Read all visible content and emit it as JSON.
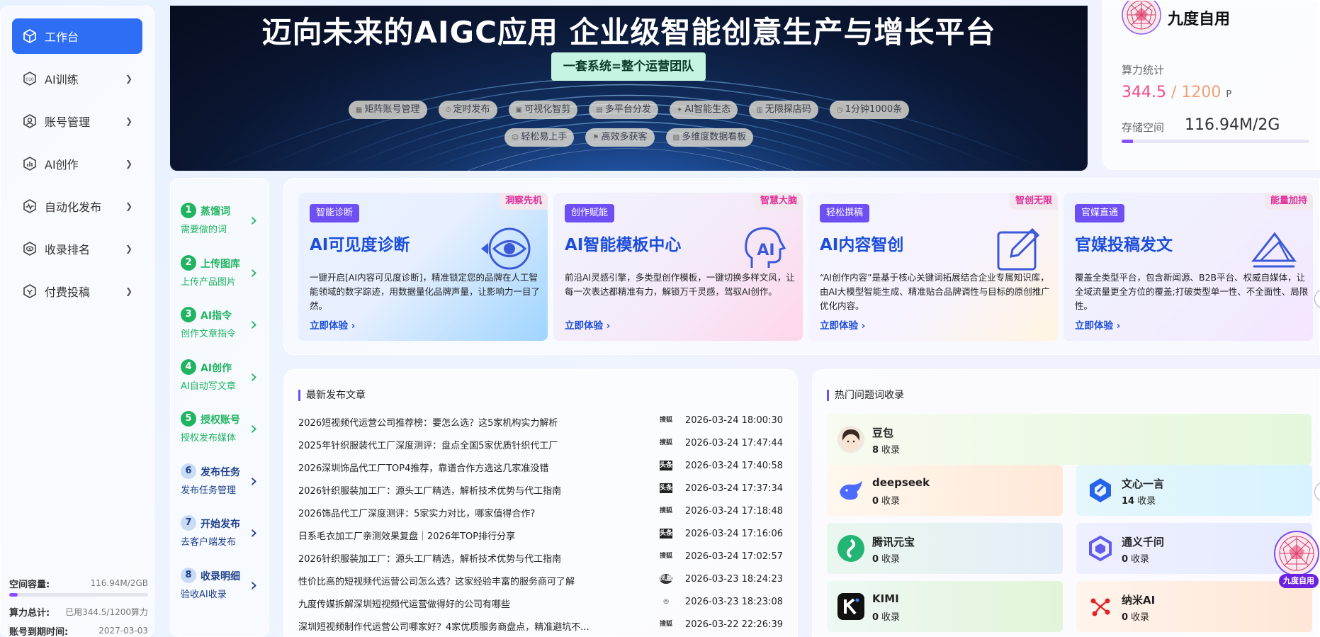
{
  "sidebar": {
    "items": [
      {
        "label": "工作台",
        "icon": "cube-icon",
        "active": true
      },
      {
        "label": "AI训练",
        "icon": "ai-train-icon"
      },
      {
        "label": "账号管理",
        "icon": "account-icon"
      },
      {
        "label": "AI创作",
        "icon": "chart-icon"
      },
      {
        "label": "自动化发布",
        "icon": "pulse-icon"
      },
      {
        "label": "收录排名",
        "icon": "eye-icon"
      },
      {
        "label": "付费投稿",
        "icon": "check-icon"
      }
    ],
    "stats": {
      "space_label": "空间容量:",
      "space_value": "116.94M/2GB",
      "space_fraction": 0.06,
      "compute_label": "算力总计:",
      "compute_value": "已用344.5/1200算力",
      "expire_label": "账号到期时间:",
      "expire_value": "2027-03-03"
    }
  },
  "banner": {
    "title": "迈向未来的AIGC应用  企业级智能创意生产与增长平台",
    "pill": "一套系统=整个运营团队",
    "tags_row1": [
      "矩阵账号管理",
      "定时发布",
      "可视化智剪",
      "多平台分发",
      "AI智能生态",
      "无限探店码",
      "1分钟1000条"
    ],
    "tags_row2": [
      "轻松易上手",
      "高效多获客",
      "多维度数据看板"
    ]
  },
  "profile": {
    "name": "九度自用",
    "compute_label": "算力统计",
    "compute_used": "344.5",
    "compute_sep": " / ",
    "compute_total": "1200",
    "compute_unit": "P",
    "storage_label": "存储空间",
    "storage_value": "116.94M/2G",
    "storage_fraction": 0.06
  },
  "steps": [
    {
      "num": "1",
      "title": "蒸馏词",
      "sub": "需要做的词",
      "style": "g"
    },
    {
      "num": "2",
      "title": "上传图库",
      "sub": "上传产品图片",
      "style": "g"
    },
    {
      "num": "3",
      "title": "AI指令",
      "sub": "创作文章指令",
      "style": "g"
    },
    {
      "num": "4",
      "title": "AI创作",
      "sub": "AI自动写文章",
      "style": "g"
    },
    {
      "num": "5",
      "title": "授权账号",
      "sub": "授权发布媒体",
      "style": "g"
    },
    {
      "num": "6",
      "title": "发布任务",
      "sub": "发布任务管理",
      "style": "b"
    },
    {
      "num": "7",
      "title": "开始发布",
      "sub": "去客户端发布",
      "style": "b"
    },
    {
      "num": "8",
      "title": "收录明细",
      "sub": "验收AI收录",
      "style": "b"
    }
  ],
  "features": [
    {
      "badge": "智能诊断",
      "corner": "洞察先机",
      "title": "AI可见度诊断",
      "desc": "一键开启[AI内容可见度诊断]，精准锁定您的品牌在人工智能领域的数字踪迹，用数据量化品牌声量，让影响力一目了然。",
      "cta": "立即体验 ›",
      "icon": "eye-icon"
    },
    {
      "badge": "创作赋能",
      "corner": "智慧大脑",
      "title": "AI智能模板中心",
      "desc": "前沿AI灵感引擎，多类型创作模板，一键切换多样文风，让每一次表达都精准有力，解锁万千灵感，驾驭AI创作。",
      "cta": "立即体验 ›",
      "icon": "ai-head-icon"
    },
    {
      "badge": "轻松撰稿",
      "corner": "智创无限",
      "title": "AI内容智创",
      "desc": "“AI创作内容”是基于核心关键词拓展结合企业专属知识库，由AI大模型智能生成、精准贴合品牌调性与目标的原创推广优化内容。",
      "cta": "立即体验 ›",
      "icon": "edit-icon"
    },
    {
      "badge": "官媒直通",
      "corner": "能量加持",
      "title": "官媒投稿发文",
      "desc": "覆盖全类型平台，包含新闻源、B2B平台、权威自媒体，让全域流量更全方位的覆盖;打破类型单一性、不全面性、局限性。",
      "cta": "立即体验 ›",
      "icon": "send-icon"
    }
  ],
  "articles": {
    "title": "最新发布文章",
    "rows": [
      {
        "title": "2026短视频代运营公司推荐榜：要怎么选？这5家机构实力解析",
        "src": "sohu",
        "date": "2026-03-24 18:00:30"
      },
      {
        "title": "2025年针织服装代工厂深度测评：盘点全国5家优质针织代工厂",
        "src": "sohu",
        "date": "2026-03-24 17:47:44"
      },
      {
        "title": "2026深圳饰品代工厂TOP4推荐，靠谱合作方选这几家准没错",
        "src": "toutiao",
        "date": "2026-03-24 17:40:58"
      },
      {
        "title": "2026针织服装加工厂：源头工厂精选，解析技术优势与代工指南",
        "src": "toutiao",
        "date": "2026-03-24 17:37:34"
      },
      {
        "title": "2026饰品代工厂深度测评：5家实力对比，哪家值得合作?",
        "src": "sohu",
        "date": "2026-03-24 17:18:48"
      },
      {
        "title": "日系毛衣加工厂亲测效果复盘｜2026年TOP排行分享",
        "src": "toutiao",
        "date": "2026-03-24 17:16:06"
      },
      {
        "title": "2026针织服装加工厂：源头工厂精选，解析技术优势与代工指南",
        "src": "sohu",
        "date": "2026-03-24 17:02:57"
      },
      {
        "title": "性价比高的短视频代运营公司怎么选？这家经验丰富的服务商可了解",
        "src": "ifeng",
        "date": "2026-03-23 18:24:23"
      },
      {
        "title": "九度传媒拆解深圳短视频代运营做得好的公司有哪些",
        "src": "other",
        "date": "2026-03-23 18:23:08"
      },
      {
        "title": "深圳短视频制作代运营公司哪家好？4家优质服务商盘点，精准避坑不...",
        "src": "sohu",
        "date": "2026-03-22 22:26:39"
      }
    ]
  },
  "hot": {
    "title": "热门问题词收录",
    "suffix": "收录",
    "items": [
      {
        "name": "豆包",
        "count": "8",
        "logo": "doubao-icon"
      },
      {
        "name": "deepseek",
        "count": "0",
        "logo": "deepseek-icon"
      },
      {
        "name": "文心一言",
        "count": "14",
        "logo": "wenxin-icon"
      },
      {
        "name": "腾讯元宝",
        "count": "0",
        "logo": "yuanbao-icon"
      },
      {
        "name": "通义千问",
        "count": "0",
        "logo": "tongyi-icon"
      },
      {
        "name": "KIMI",
        "count": "0",
        "logo": "kimi-icon"
      },
      {
        "name": "纳米AI",
        "count": "0",
        "logo": "nami-icon"
      }
    ]
  },
  "float_badge": "九度自用",
  "colors": {
    "primary": "#2e6ef5",
    "accent_purple": "#6e4ff4",
    "green": "#21b460",
    "pink": "#f24a8a"
  }
}
